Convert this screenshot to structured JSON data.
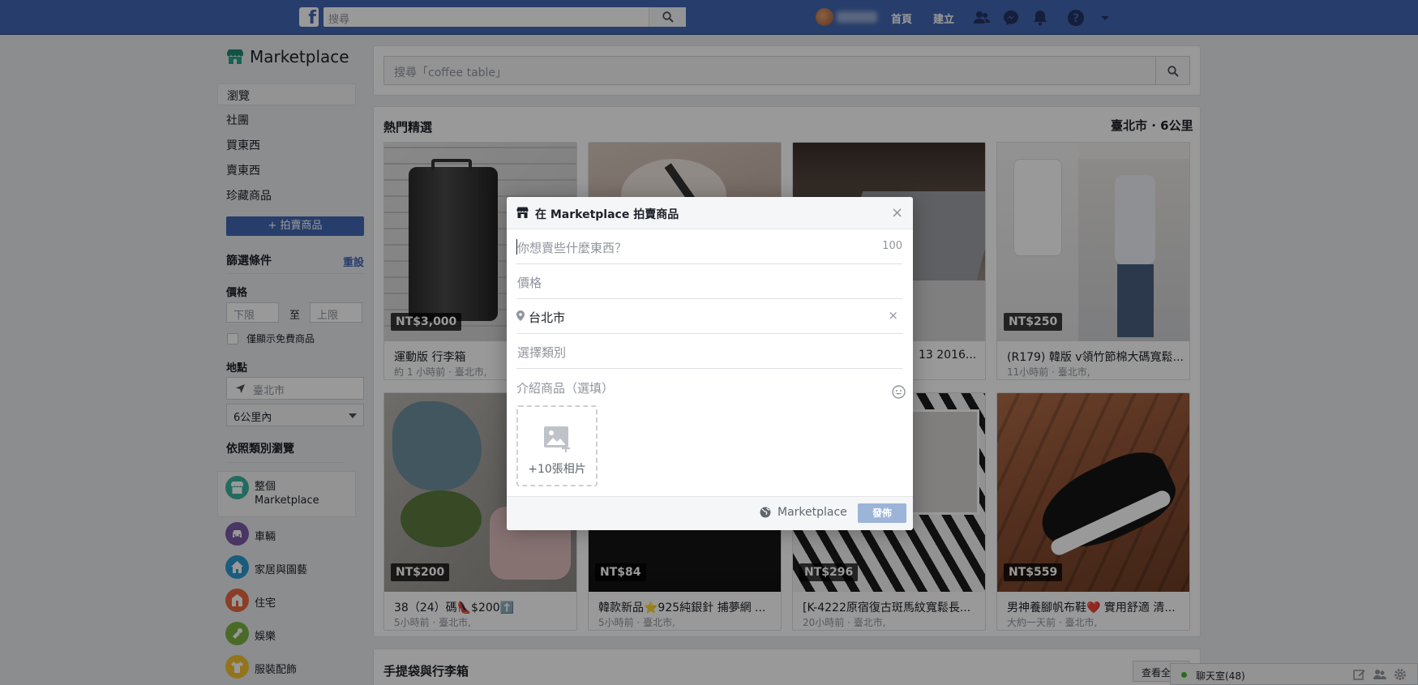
{
  "topbar": {
    "search_placeholder": "搜尋",
    "home": "首頁",
    "create": "建立",
    "icons": [
      "friends-icon",
      "messenger-icon",
      "notifications-icon",
      "help-icon",
      "account-menu-icon"
    ]
  },
  "sidebar": {
    "title": "Marketplace",
    "nav": [
      "瀏覽",
      "社團",
      "買東西",
      "賣東西",
      "珍藏商品"
    ],
    "sell_button": "+ 拍賣商品",
    "filters_title": "篩選條件",
    "reset": "重設",
    "price_label": "價格",
    "min_placeholder": "下限",
    "to": "至",
    "max_placeholder": "上限",
    "free_only": "僅顯示免費商品",
    "location_label": "地點",
    "location_placeholder": "臺北市",
    "radius": "6公里內",
    "browse_title": "依照類別瀏覽",
    "categories": [
      {
        "label": "整個\nMarketplace",
        "color": "#3bb39e"
      },
      {
        "label": "車輛",
        "color": "#7b5ba8"
      },
      {
        "label": "家居與園藝",
        "color": "#2c9ad1"
      },
      {
        "label": "住宅",
        "color": "#e9663e"
      },
      {
        "label": "娛樂",
        "color": "#7cb342"
      },
      {
        "label": "服裝配飾",
        "color": "#f2c230"
      }
    ]
  },
  "main": {
    "search_placeholder": "搜尋「coffee table」",
    "feed_title": "熱門精選",
    "feed_location": "臺北市 · 6公里",
    "cards": [
      {
        "price": "NT$3,000",
        "title": "運動版 行李箱",
        "meta": "約 1 小時前 · 臺北市,"
      },
      {
        "price": "",
        "title": "",
        "meta": ""
      },
      {
        "price": "",
        "title": "13 2016...",
        "meta": ""
      },
      {
        "price": "NT$250",
        "title": "(R179) 韓版 v領竹節棉大碼寬鬆...",
        "meta": "11小時前 · 臺北市,"
      },
      {
        "price": "NT$200",
        "title": "38（24）碼👠$200⬆️",
        "meta": "5小時前 · 臺北市,"
      },
      {
        "price": "NT$84",
        "title": "韓款新品⭐925純銀針 捕夢網 ...",
        "meta": "5小時前 · 臺北市,"
      },
      {
        "price": "NT$296",
        "title": "[K-4222原宿復古斑馬紋寬鬆長...",
        "meta": "20小時前 · 臺北市,"
      },
      {
        "price": "NT$559",
        "title": "男神養腳帆布鞋❤️ 實用舒適 清...",
        "meta": "大約一天前 · 臺北市,"
      }
    ],
    "bottom_title": "手提袋與行李箱",
    "see_all": "查看全部"
  },
  "chat": {
    "label": "聊天室(48)"
  },
  "modal": {
    "title": "在 Marketplace 拍賣商品",
    "close": "×",
    "what_placeholder": "你想賣些什麼東西？",
    "char_count": "100",
    "price_placeholder": "價格",
    "location_value": "台北市",
    "clear": "×",
    "category_placeholder": "選擇類別",
    "description_placeholder": "介紹商品（選填）",
    "photo_label": "+10張相片",
    "audience": "Marketplace",
    "publish": "發佈"
  }
}
